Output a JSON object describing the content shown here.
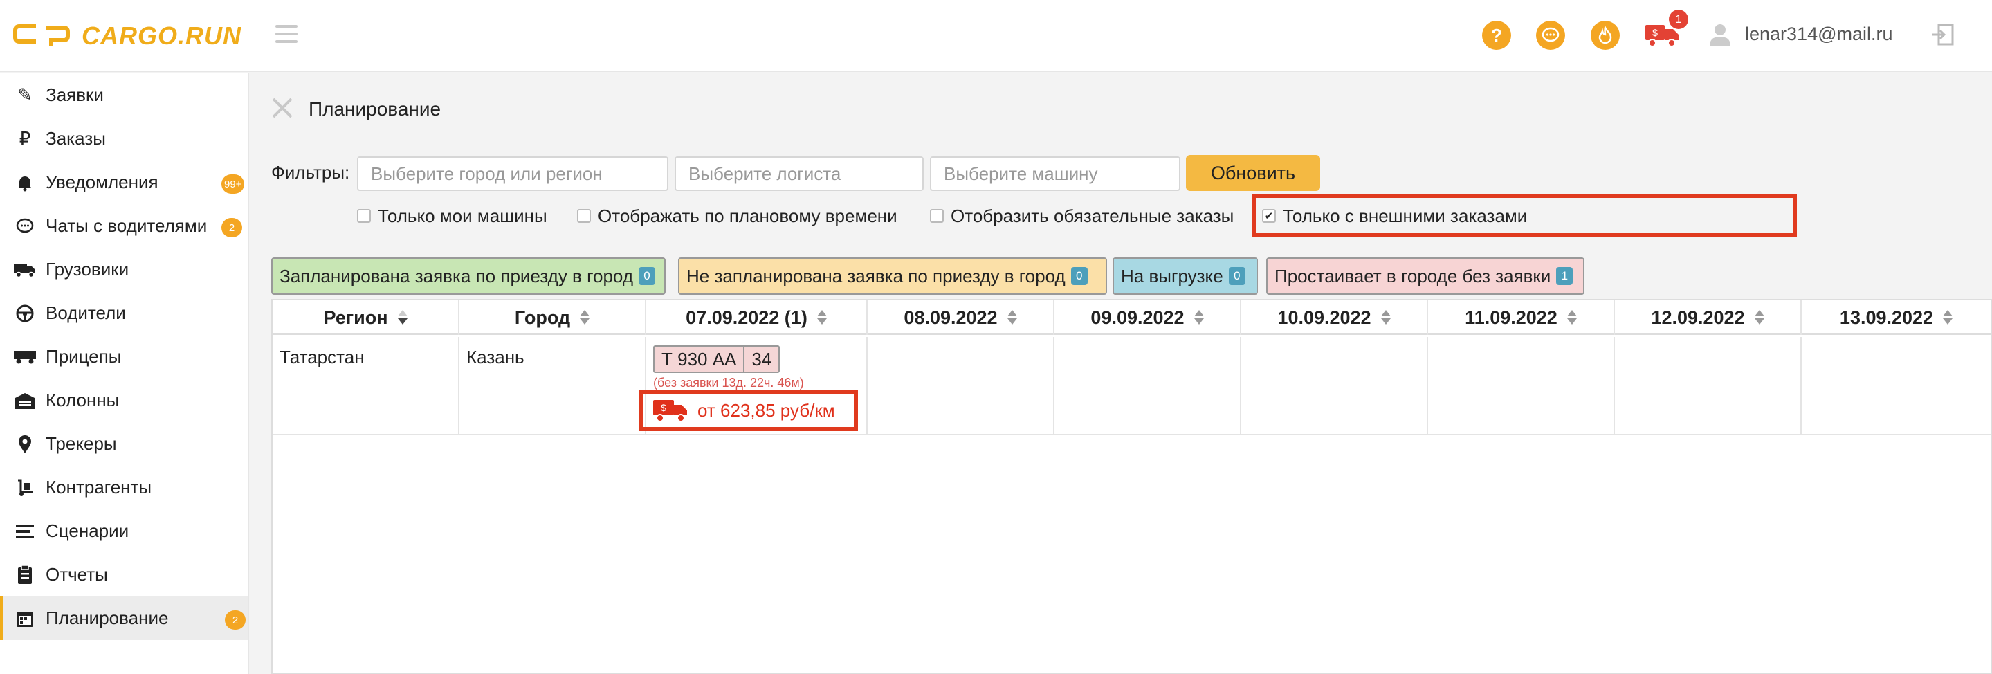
{
  "header": {
    "logo_text": "CARGO.RUN",
    "help_icon": "?",
    "truck_badge": "1",
    "user_email": "lenar314@mail.ru"
  },
  "sidebar": {
    "items": [
      {
        "label": "Заявки",
        "icon": "edit-icon"
      },
      {
        "label": "Заказы",
        "icon": "ruble-icon"
      },
      {
        "label": "Уведомления",
        "icon": "bell-icon",
        "badge": "99+"
      },
      {
        "label": "Чаты с водителями",
        "icon": "chat-icon",
        "badge": "2"
      },
      {
        "label": "Грузовики",
        "icon": "truck-icon"
      },
      {
        "label": "Водители",
        "icon": "steering-wheel-icon"
      },
      {
        "label": "Прицепы",
        "icon": "trailer-icon"
      },
      {
        "label": "Колонны",
        "icon": "warehouse-icon"
      },
      {
        "label": "Трекеры",
        "icon": "map-pin-icon"
      },
      {
        "label": "Контрагенты",
        "icon": "dolly-icon"
      },
      {
        "label": "Сценарии",
        "icon": "list-icon"
      },
      {
        "label": "Отчеты",
        "icon": "clipboard-icon"
      },
      {
        "label": "Планирование",
        "icon": "calendar-icon",
        "badge": "2",
        "active": true
      }
    ]
  },
  "page": {
    "title": "Планирование",
    "filters_label": "Фильтры:",
    "city_placeholder": "Выберите город или регион",
    "logist_placeholder": "Выберите логиста",
    "truck_placeholder": "Выберите машину",
    "update_button": "Обновить"
  },
  "checkboxes": [
    {
      "label": "Только мои машины",
      "checked": false
    },
    {
      "label": "Отображать по плановому времени",
      "checked": false
    },
    {
      "label": "Отобразить обязательные заказы",
      "checked": false
    },
    {
      "label": "Только с внешними заказами",
      "checked": true
    }
  ],
  "legend": [
    {
      "label": "Запланирована заявка по приезду в город",
      "count": "0",
      "color": "#c8e6b4"
    },
    {
      "label": "Не запланирована заявка по приезду в город",
      "count": "0",
      "color": "#fbe0a8"
    },
    {
      "label": "На выгрузке",
      "count": "0",
      "color": "#a8d8e3"
    },
    {
      "label": "Простаивает в городе без заявки",
      "count": "1",
      "color": "#f7d4d4"
    }
  ],
  "table": {
    "columns": [
      "Регион",
      "Город",
      "07.09.2022 (1)",
      "08.09.2022",
      "09.09.2022",
      "10.09.2022",
      "11.09.2022",
      "12.09.2022",
      "13.09.2022"
    ],
    "rows": [
      {
        "region": "Татарстан",
        "city": "Казань",
        "plate_number": "Т 930 АА",
        "plate_region": "34",
        "idle_note": "(без заявки 13д. 22ч. 46м)",
        "price": "от 623,85 руб/км"
      }
    ]
  }
}
